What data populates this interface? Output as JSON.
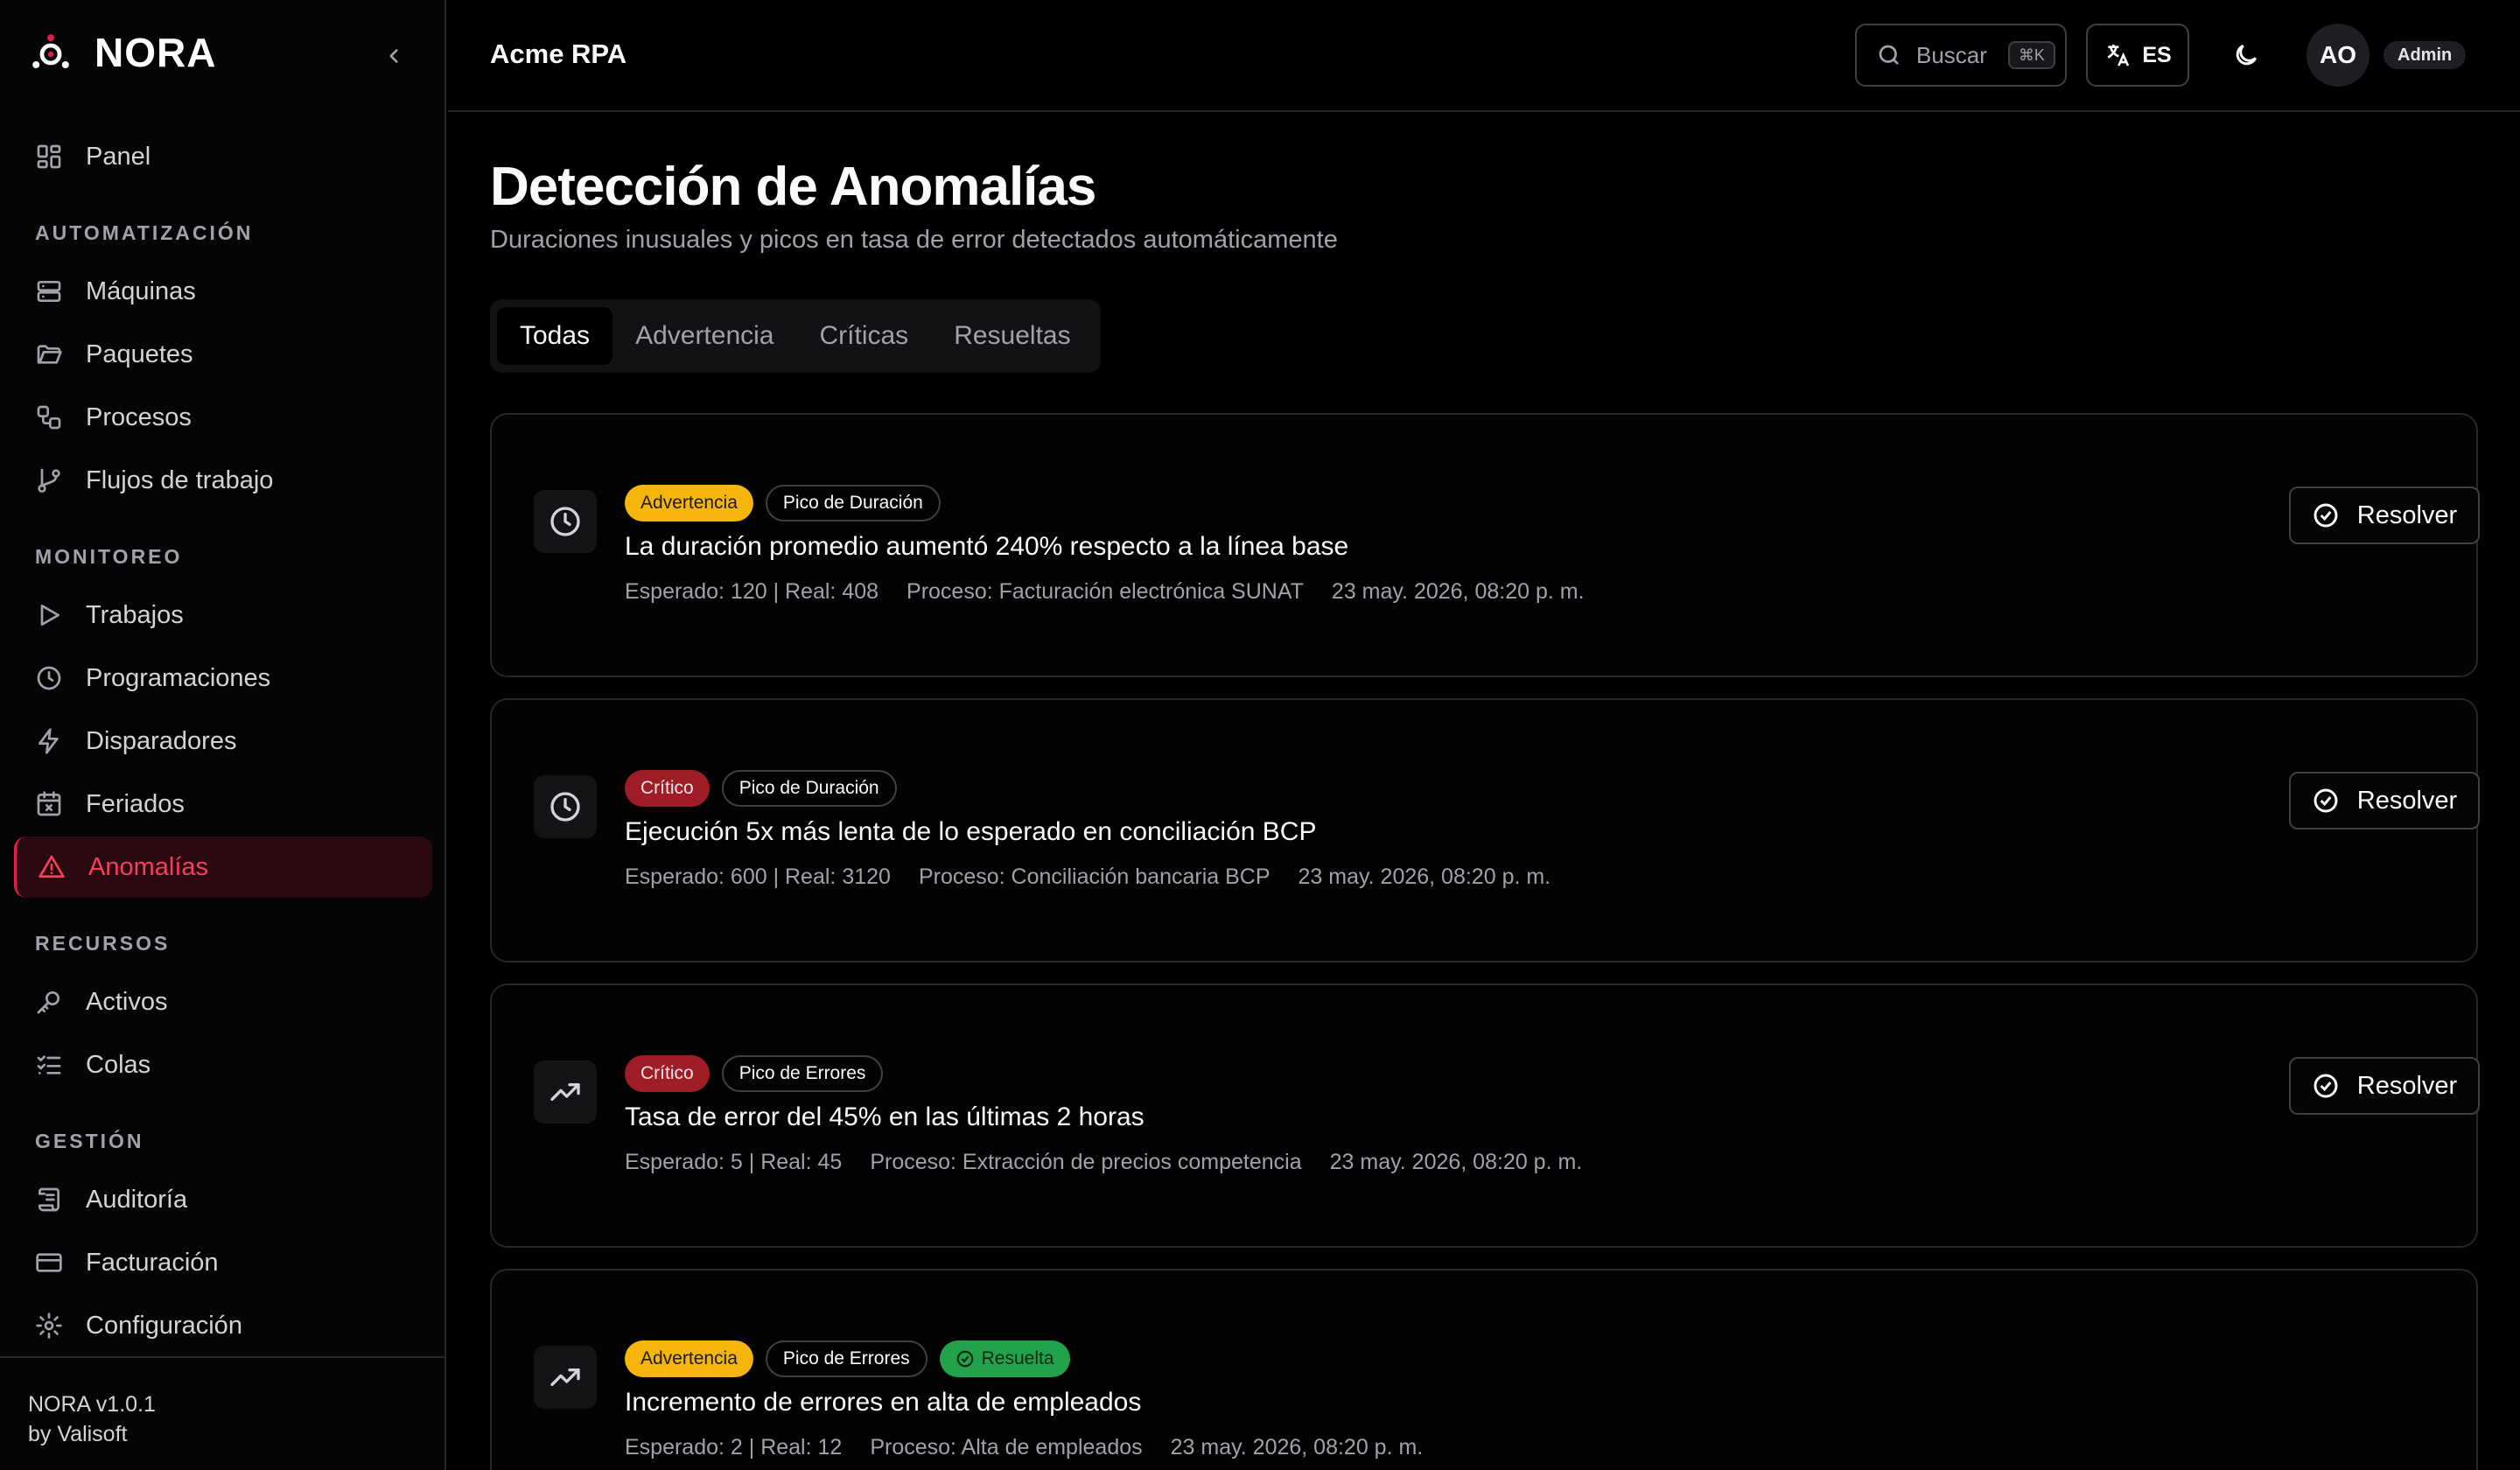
{
  "brand": {
    "name": "NORA",
    "accent": "#e11d48",
    "logo_icon": "nora-logo-icon"
  },
  "sidebar": {
    "collapse_icon": "chevron-left-icon",
    "top_item": {
      "label": "Panel",
      "icon": "layout-dashboard-icon"
    },
    "sections": [
      {
        "title": "AUTOMATIZACIÓN",
        "items": [
          {
            "label": "Máquinas",
            "icon": "server-icon"
          },
          {
            "label": "Paquetes",
            "icon": "folder-open-icon"
          },
          {
            "label": "Procesos",
            "icon": "workflow-icon"
          },
          {
            "label": "Flujos de trabajo",
            "icon": "git-branch-icon"
          }
        ]
      },
      {
        "title": "MONITOREO",
        "items": [
          {
            "label": "Trabajos",
            "icon": "play-icon"
          },
          {
            "label": "Programaciones",
            "icon": "clock-icon"
          },
          {
            "label": "Disparadores",
            "icon": "zap-icon"
          },
          {
            "label": "Feriados",
            "icon": "calendar-x-icon"
          },
          {
            "label": "Anomalías",
            "icon": "alert-triangle-icon",
            "active": true
          }
        ]
      },
      {
        "title": "RECURSOS",
        "items": [
          {
            "label": "Activos",
            "icon": "key-icon"
          },
          {
            "label": "Colas",
            "icon": "list-checks-icon"
          }
        ]
      },
      {
        "title": "GESTIÓN",
        "items": [
          {
            "label": "Auditoría",
            "icon": "scroll-text-icon"
          },
          {
            "label": "Facturación",
            "icon": "credit-card-icon"
          },
          {
            "label": "Configuración",
            "icon": "settings-icon"
          }
        ]
      }
    ],
    "footer": {
      "version": "NORA v1.0.1",
      "by": "by Valisoft"
    }
  },
  "header": {
    "org": "Acme RPA",
    "search": {
      "label": "Buscar",
      "shortcut": "⌘K",
      "icon": "search-icon"
    },
    "language": {
      "code": "ES",
      "icon": "languages-icon"
    },
    "theme_icon": "moon-icon",
    "user": {
      "initials": "AO",
      "role": "Admin"
    }
  },
  "page": {
    "title": "Detección de Anomalías",
    "subtitle": "Duraciones inusuales y picos en tasa de error detectados automáticamente",
    "tabs": [
      {
        "label": "Todas",
        "active": true
      },
      {
        "label": "Advertencia"
      },
      {
        "label": "Críticas"
      },
      {
        "label": "Resueltas"
      }
    ],
    "resolve_label": "Resolver",
    "anomalies": [
      {
        "icon": "clock-icon",
        "severity": "Advertencia",
        "severity_kind": "warn",
        "type": "Pico de Duración",
        "title": "La duración promedio aumentó 240% respecto a la línea base",
        "expected_actual": "Esperado: 120 | Real: 408",
        "process": "Proceso: Facturación electrónica SUNAT",
        "date": "23 may. 2026, 08:20 p. m."
      },
      {
        "icon": "clock-icon",
        "severity": "Crítico",
        "severity_kind": "crit",
        "type": "Pico de Duración",
        "title": "Ejecución 5x más lenta de lo esperado en conciliación BCP",
        "expected_actual": "Esperado: 600 | Real: 3120",
        "process": "Proceso: Conciliación bancaria BCP",
        "date": "23 may. 2026, 08:20 p. m."
      },
      {
        "icon": "trending-up-icon",
        "severity": "Crítico",
        "severity_kind": "crit",
        "type": "Pico de Errores",
        "title": "Tasa de error del 45% en las últimas 2 horas",
        "expected_actual": "Esperado: 5 | Real: 45",
        "process": "Proceso: Extracción de precios competencia",
        "date": "23 may. 2026, 08:20 p. m."
      },
      {
        "icon": "trending-up-icon",
        "severity": "Advertencia",
        "severity_kind": "warn",
        "type": "Pico de Errores",
        "status": "Resuelta",
        "title": "Incremento de errores en alta de empleados",
        "expected_actual": "Esperado: 2 | Real: 12",
        "process": "Proceso: Alta de empleados",
        "date": "23 may. 2026, 08:20 p. m."
      }
    ]
  },
  "colors": {
    "warning": "#f5b50a",
    "critical": "#9f1d26",
    "resolved": "#22a24a",
    "active_nav_bg": "#2a0a10",
    "active_nav_text": "#f43f5e"
  }
}
